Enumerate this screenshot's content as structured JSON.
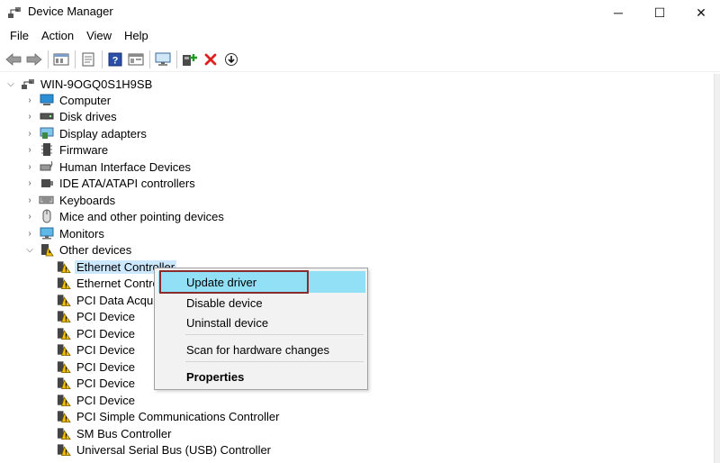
{
  "window": {
    "title": "Device Manager",
    "controls": {
      "minimize": "─",
      "maximize": "☐",
      "close": "✕"
    }
  },
  "menu": [
    "File",
    "Action",
    "View",
    "Help"
  ],
  "toolbar": {
    "buttons": [
      "back-icon",
      "forward-icon",
      "show-hide-icon",
      "properties-icon",
      "help-icon",
      "view-icon",
      "monitor-icon",
      "add-driver-icon",
      "uninstall-icon",
      "update-icon"
    ],
    "colors": {
      "uninstall": "#e02020",
      "add": "#1e9e1e"
    }
  },
  "tree": {
    "root": "WIN-9OGQ0S1H9SB",
    "categories": [
      {
        "label": "Computer",
        "expanded": false,
        "icon": "computer-icon"
      },
      {
        "label": "Disk drives",
        "expanded": false,
        "icon": "disk-icon"
      },
      {
        "label": "Display adapters",
        "expanded": false,
        "icon": "display-adapter-icon"
      },
      {
        "label": "Firmware",
        "expanded": false,
        "icon": "firmware-icon"
      },
      {
        "label": "Human Interface Devices",
        "expanded": false,
        "icon": "hid-icon"
      },
      {
        "label": "IDE ATA/ATAPI controllers",
        "expanded": false,
        "icon": "ide-icon"
      },
      {
        "label": "Keyboards",
        "expanded": false,
        "icon": "keyboard-icon"
      },
      {
        "label": "Mice and other pointing devices",
        "expanded": false,
        "icon": "mouse-icon"
      },
      {
        "label": "Monitors",
        "expanded": false,
        "icon": "monitor-icon"
      },
      {
        "label": "Other devices",
        "expanded": true,
        "icon": "other-devices-icon"
      }
    ],
    "other_devices": [
      "Ethernet Controller",
      "Ethernet Contro",
      "PCI Data Acquis",
      "PCI Device",
      "PCI Device",
      "PCI Device",
      "PCI Device",
      "PCI Device",
      "PCI Device",
      "PCI Simple Communications Controller",
      "SM Bus Controller",
      "Universal Serial Bus (USB) Controller"
    ]
  },
  "context_menu": {
    "items": [
      "Update driver",
      "Disable device",
      "Uninstall device",
      "Scan for hardware changes",
      "Properties"
    ],
    "highlighted": "Update driver",
    "highlight_color": "#91e0f5",
    "outline_color": "#8b2c2c"
  },
  "colors": {
    "selection": "#cce8ff"
  }
}
